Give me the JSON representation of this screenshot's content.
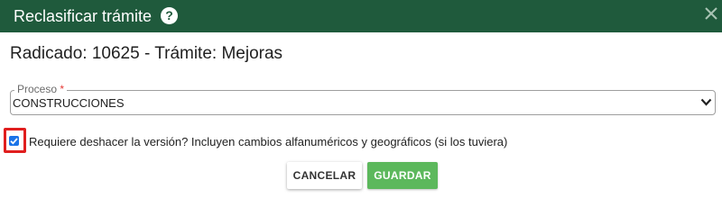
{
  "dialog": {
    "title": "Reclasificar trámite",
    "help_symbol": "?",
    "header_color": "#1f5a3c"
  },
  "heading": "Radicado: 10625 - Trámite: Mejoras",
  "proceso": {
    "label": "Proceso",
    "required_mark": "*",
    "value": "CONSTRUCCIONES"
  },
  "checkbox": {
    "checked": true,
    "label": "Requiere deshacer la versión? Incluyen cambios alfanuméricos y geográficos (si los tuviera)",
    "accent_color": "#1a73e8",
    "highlight_color": "#e01e1e"
  },
  "buttons": {
    "cancel_label": "CANCELAR",
    "save_label": "GUARDAR",
    "save_color": "#5cb85c"
  }
}
